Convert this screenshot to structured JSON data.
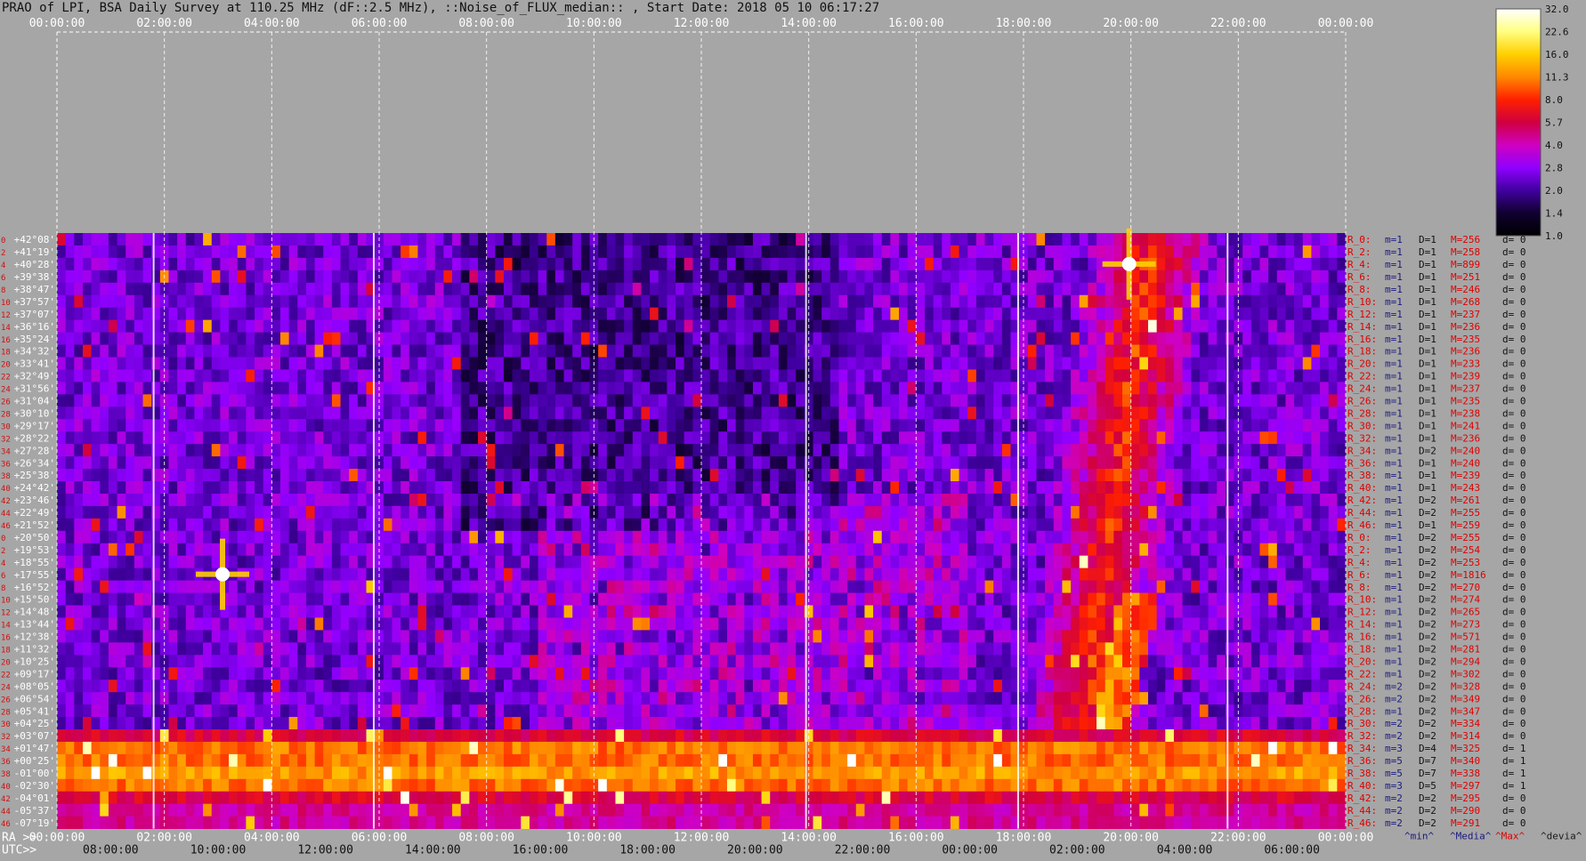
{
  "title": "PRAO of LPI, BSA Daily Survey at 110.25 MHz (dF::2.5 MHz), ::Noise_of_FLUX_median:: , Start Date: 2018 05 10 06:17:27",
  "chart_data": {
    "type": "heatmap",
    "title": "PRAO of LPI, BSA Daily Survey at 110.25 MHz (dF::2.5 MHz), ::Noise_of_FLUX_median:: , Start Date: 2018 05 10 06:17:27",
    "top_axis_ticks": [
      "00:00:00",
      "02:00:00",
      "04:00:00",
      "06:00:00",
      "08:00:00",
      "10:00:00",
      "12:00:00",
      "14:00:00",
      "16:00:00",
      "18:00:00",
      "20:00:00",
      "22:00:00",
      "00:00:00"
    ],
    "ra_axis_label": "RA >>",
    "ra_axis_ticks": [
      "00:00:00",
      "02:00:00",
      "04:00:00",
      "06:00:00",
      "08:00:00",
      "10:00:00",
      "12:00:00",
      "14:00:00",
      "16:00:00",
      "18:00:00",
      "20:00:00",
      "22:00:00",
      "00:00:00"
    ],
    "utc_axis_label": "UTC>>",
    "utc_axis_ticks": [
      "08:00:00",
      "10:00:00",
      "12:00:00",
      "14:00:00",
      "16:00:00",
      "18:00:00",
      "20:00:00",
      "22:00:00",
      "00:00:00",
      "02:00:00",
      "04:00:00",
      "06:00:00"
    ],
    "declinations": [
      "+42°08'",
      "+41°19'",
      "+40°28'",
      "+39°38'",
      "+38°47'",
      "+37°57'",
      "+37°07'",
      "+36°16'",
      "+35°24'",
      "+34°32'",
      "+33°41'",
      "+32°49'",
      "+31°56'",
      "+31°04'",
      "+30°10'",
      "+29°17'",
      "+28°22'",
      "+27°28'",
      "+26°34'",
      "+25°38'",
      "+24°42'",
      "+23°46'",
      "+22°49'",
      "+21°52'",
      "+20°50'",
      "+19°53'",
      "+18°55'",
      "+17°55'",
      "+16°52'",
      "+15°50'",
      "+14°48'",
      "+13°44'",
      "+12°38'",
      "+11°32'",
      "+10°25'",
      "+09°17'",
      "+08°05'",
      "+06°54'",
      "+05°41'",
      "+04°25'",
      "+03°07'",
      "+01°47'",
      "+00°25'",
      "-01°00'",
      "-02°30'",
      "-04°01'",
      "-05°37'",
      "-07°19'"
    ],
    "colorbar": {
      "ticks": [
        "32.0",
        "22.6",
        "16.0",
        "11.3",
        "8.0",
        "5.7",
        "4.0",
        "2.8",
        "2.0",
        "1.4",
        "1.0"
      ],
      "colors": [
        "#ffffff",
        "#ffff80",
        "#ffd000",
        "#ff8800",
        "#ff2000",
        "#d00040",
        "#d000c0",
        "#9000ff",
        "#4000a0",
        "#100030",
        "#000000"
      ]
    },
    "row_stats": [
      {
        "r": "R_0:",
        "m": "m=1",
        "D": "D=1",
        "M": "M=256",
        "d": "d= 0"
      },
      {
        "r": "R_2:",
        "m": "m=1",
        "D": "D=1",
        "M": "M=258",
        "d": "d= 0"
      },
      {
        "r": "R_4:",
        "m": "m=1",
        "D": "D=1",
        "M": "M=899",
        "d": "d= 0"
      },
      {
        "r": "R_6:",
        "m": "m=1",
        "D": "D=1",
        "M": "M=251",
        "d": "d= 0"
      },
      {
        "r": "R_8:",
        "m": "m=1",
        "D": "D=1",
        "M": "M=246",
        "d": "d= 0"
      },
      {
        "r": "R_10:",
        "m": "m=1",
        "D": "D=1",
        "M": "M=268",
        "d": "d= 0"
      },
      {
        "r": "R_12:",
        "m": "m=1",
        "D": "D=1",
        "M": "M=237",
        "d": "d= 0"
      },
      {
        "r": "R_14:",
        "m": "m=1",
        "D": "D=1",
        "M": "M=236",
        "d": "d= 0"
      },
      {
        "r": "R_16:",
        "m": "m=1",
        "D": "D=1",
        "M": "M=235",
        "d": "d= 0"
      },
      {
        "r": "R_18:",
        "m": "m=1",
        "D": "D=1",
        "M": "M=236",
        "d": "d= 0"
      },
      {
        "r": "R_20:",
        "m": "m=1",
        "D": "D=1",
        "M": "M=233",
        "d": "d= 0"
      },
      {
        "r": "R_22:",
        "m": "m=1",
        "D": "D=1",
        "M": "M=239",
        "d": "d= 0"
      },
      {
        "r": "R_24:",
        "m": "m=1",
        "D": "D=1",
        "M": "M=237",
        "d": "d= 0"
      },
      {
        "r": "R_26:",
        "m": "m=1",
        "D": "D=1",
        "M": "M=235",
        "d": "d= 0"
      },
      {
        "r": "R_28:",
        "m": "m=1",
        "D": "D=1",
        "M": "M=238",
        "d": "d= 0"
      },
      {
        "r": "R_30:",
        "m": "m=1",
        "D": "D=1",
        "M": "M=241",
        "d": "d= 0"
      },
      {
        "r": "R_32:",
        "m": "m=1",
        "D": "D=1",
        "M": "M=236",
        "d": "d= 0"
      },
      {
        "r": "R_34:",
        "m": "m=1",
        "D": "D=2",
        "M": "M=240",
        "d": "d= 0"
      },
      {
        "r": "R_36:",
        "m": "m=1",
        "D": "D=1",
        "M": "M=240",
        "d": "d= 0"
      },
      {
        "r": "R_38:",
        "m": "m=1",
        "D": "D=1",
        "M": "M=239",
        "d": "d= 0"
      },
      {
        "r": "R_40:",
        "m": "m=1",
        "D": "D=1",
        "M": "M=243",
        "d": "d= 0"
      },
      {
        "r": "R_42:",
        "m": "m=1",
        "D": "D=2",
        "M": "M=261",
        "d": "d= 0"
      },
      {
        "r": "R_44:",
        "m": "m=1",
        "D": "D=2",
        "M": "M=255",
        "d": "d= 0"
      },
      {
        "r": "R_46:",
        "m": "m=1",
        "D": "D=1",
        "M": "M=259",
        "d": "d= 0"
      },
      {
        "r": "R_0:",
        "m": "m=1",
        "D": "D=2",
        "M": "M=255",
        "d": "d= 0"
      },
      {
        "r": "R_2:",
        "m": "m=1",
        "D": "D=2",
        "M": "M=254",
        "d": "d= 0"
      },
      {
        "r": "R_4:",
        "m": "m=1",
        "D": "D=2",
        "M": "M=253",
        "d": "d= 0"
      },
      {
        "r": "R_6:",
        "m": "m=1",
        "D": "D=2",
        "M": "M=1816",
        "d": "d= 0"
      },
      {
        "r": "R_8:",
        "m": "m=1",
        "D": "D=2",
        "M": "M=270",
        "d": "d= 0"
      },
      {
        "r": "R_10:",
        "m": "m=1",
        "D": "D=2",
        "M": "M=274",
        "d": "d= 0"
      },
      {
        "r": "R_12:",
        "m": "m=1",
        "D": "D=2",
        "M": "M=265",
        "d": "d= 0"
      },
      {
        "r": "R_14:",
        "m": "m=1",
        "D": "D=2",
        "M": "M=273",
        "d": "d= 0"
      },
      {
        "r": "R_16:",
        "m": "m=1",
        "D": "D=2",
        "M": "M=571",
        "d": "d= 0"
      },
      {
        "r": "R_18:",
        "m": "m=1",
        "D": "D=2",
        "M": "M=281",
        "d": "d= 0"
      },
      {
        "r": "R_20:",
        "m": "m=1",
        "D": "D=2",
        "M": "M=294",
        "d": "d= 0"
      },
      {
        "r": "R_22:",
        "m": "m=1",
        "D": "D=2",
        "M": "M=302",
        "d": "d= 0"
      },
      {
        "r": "R_24:",
        "m": "m=2",
        "D": "D=2",
        "M": "M=328",
        "d": "d= 0"
      },
      {
        "r": "R_26:",
        "m": "m=2",
        "D": "D=2",
        "M": "M=349",
        "d": "d= 0"
      },
      {
        "r": "R_28:",
        "m": "m=1",
        "D": "D=2",
        "M": "M=347",
        "d": "d= 0"
      },
      {
        "r": "R_30:",
        "m": "m=2",
        "D": "D=2",
        "M": "M=334",
        "d": "d= 0"
      },
      {
        "r": "R_32:",
        "m": "m=2",
        "D": "D=2",
        "M": "M=314",
        "d": "d= 0"
      },
      {
        "r": "R_34:",
        "m": "m=3",
        "D": "D=4",
        "M": "M=325",
        "d": "d= 1"
      },
      {
        "r": "R_36:",
        "m": "m=5",
        "D": "D=7",
        "M": "M=340",
        "d": "d= 1"
      },
      {
        "r": "R_38:",
        "m": "m=5",
        "D": "D=7",
        "M": "M=338",
        "d": "d= 1"
      },
      {
        "r": "R_40:",
        "m": "m=3",
        "D": "D=5",
        "M": "M=297",
        "d": "d= 1"
      },
      {
        "r": "R_42:",
        "m": "m=2",
        "D": "D=2",
        "M": "M=295",
        "d": "d= 0"
      },
      {
        "r": "R_44:",
        "m": "m=2",
        "D": "D=2",
        "M": "M=290",
        "d": "d= 0"
      },
      {
        "r": "R_46:",
        "m": "m=2",
        "D": "D=2",
        "M": "M=291",
        "d": "d= 0"
      }
    ],
    "stats_legend": [
      "^min^",
      "^Media^",
      "^Max^",
      "^devia^"
    ],
    "stats_legend_colors": [
      "#1a1a80",
      "#1a1a80",
      "#e00000",
      "#1a1a1a"
    ],
    "row_index_labels": [
      "0",
      "2",
      "4",
      "6",
      "8",
      "10",
      "12",
      "14",
      "16",
      "18",
      "20",
      "22",
      "24",
      "26",
      "28",
      "30",
      "32",
      "34",
      "36",
      "38",
      "40",
      "42",
      "44",
      "46",
      "0",
      "2",
      "4",
      "6",
      "8",
      "10",
      "12",
      "14",
      "16",
      "18",
      "20",
      "22",
      "24",
      "26",
      "28",
      "30",
      "32",
      "34",
      "36",
      "38",
      "40",
      "42",
      "44",
      "46"
    ],
    "features": [
      {
        "name": "equatorial-band",
        "dec_from": "+03°07'",
        "dec_to": "-02°30'",
        "level": "high"
      },
      {
        "name": "bright-source-1",
        "ra": "03:05",
        "dec": "+17°55'",
        "level": "saturated"
      },
      {
        "name": "bright-source-2",
        "ra": "19:58",
        "dec": "+40°28'",
        "level": "saturated"
      },
      {
        "name": "galactic-plane-arc",
        "ra_from": "18:45",
        "ra_to": "20:30",
        "level": "high"
      }
    ]
  }
}
